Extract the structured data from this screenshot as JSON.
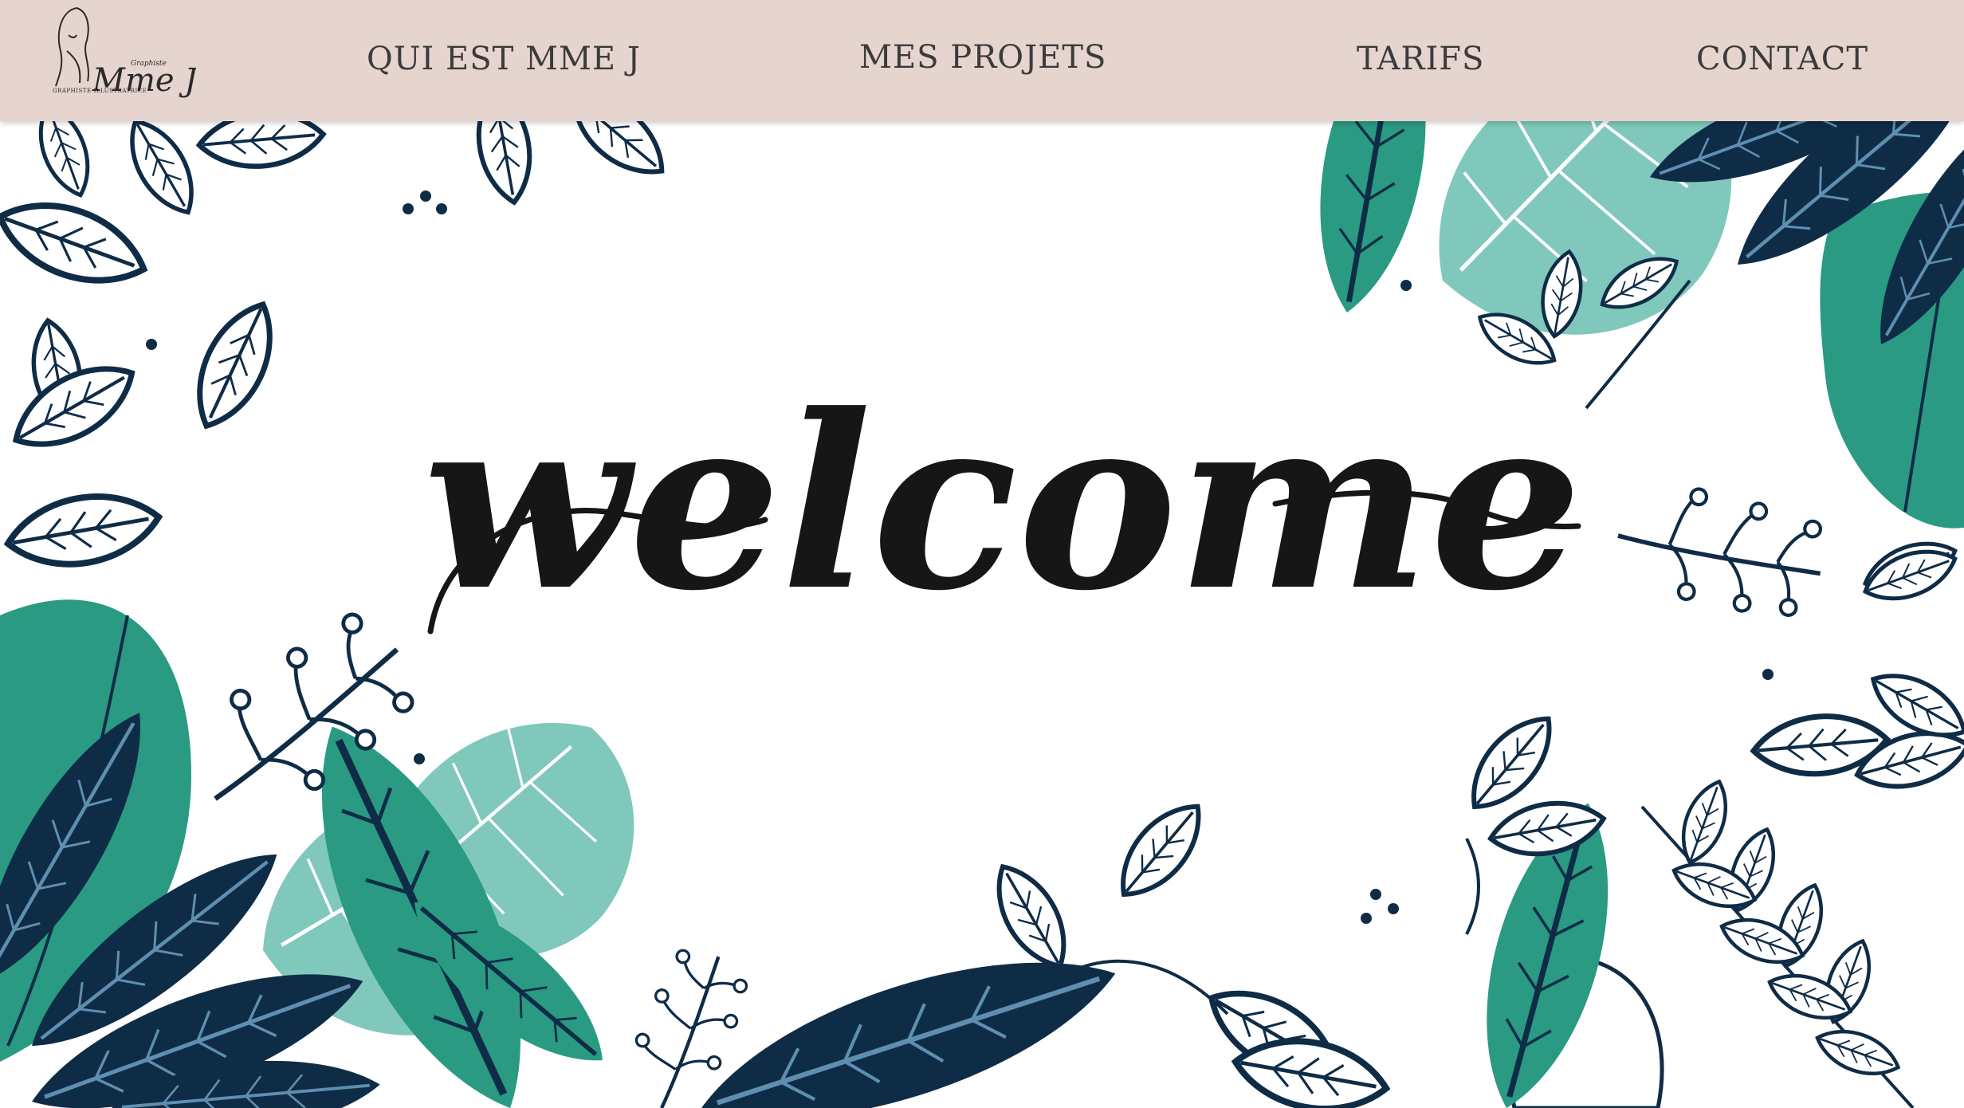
{
  "header": {
    "logo": {
      "script_text": "Mme J",
      "tagline": "GRAPHISTE-ILLUSTRATRICE",
      "signature_text": "Graphiste"
    },
    "nav": [
      {
        "label": "QUI EST MME J"
      },
      {
        "label": "MES PROJETS"
      },
      {
        "label": "TARIFS"
      },
      {
        "label": "CONTACT"
      }
    ]
  },
  "hero": {
    "title": "welcome"
  },
  "colors": {
    "header_bg": "#e6d4cf",
    "nav_text": "#3b3b3b",
    "navy_leaf": "#0f2c47",
    "teal_leaf": "#2a9a83",
    "mint_leaf": "#7fc8bb",
    "ink": "#161616"
  }
}
